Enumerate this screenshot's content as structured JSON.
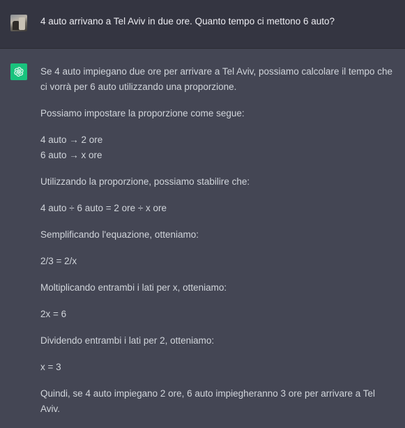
{
  "user_message": {
    "text": "4 auto arrivano a Tel Aviv in due ore. Quanto tempo ci mettono 6 auto?"
  },
  "assistant_message": {
    "paragraphs": [
      "Se 4 auto impiegano due ore per arrivare a Tel Aviv, possiamo calcolare il tempo che ci vorrà per 6 auto utilizzando una proporzione.",
      "Possiamo impostare la proporzione come segue:",
      [
        "4 auto → 2 ore",
        "6 auto → x ore"
      ],
      "Utilizzando la proporzione, possiamo stabilire che:",
      "4 auto ÷ 6 auto = 2 ore ÷ x ore",
      "Semplificando l'equazione, otteniamo:",
      "2/3 = 2/x",
      "Moltiplicando entrambi i lati per x, otteniamo:",
      "2x = 6",
      "Dividendo entrambi i lati per 2, otteniamo:",
      "x = 3",
      "Quindi, se 4 auto impiegano 2 ore, 6 auto impiegheranno 3 ore per arrivare a Tel Aviv."
    ]
  },
  "colors": {
    "user_bg": "#343541",
    "assistant_bg": "#444654",
    "bot_avatar": "#19c37d",
    "text": "#d1d5db"
  },
  "icons": {
    "user_avatar": "user-avatar-photo",
    "bot_avatar": "openai-logo-icon"
  }
}
